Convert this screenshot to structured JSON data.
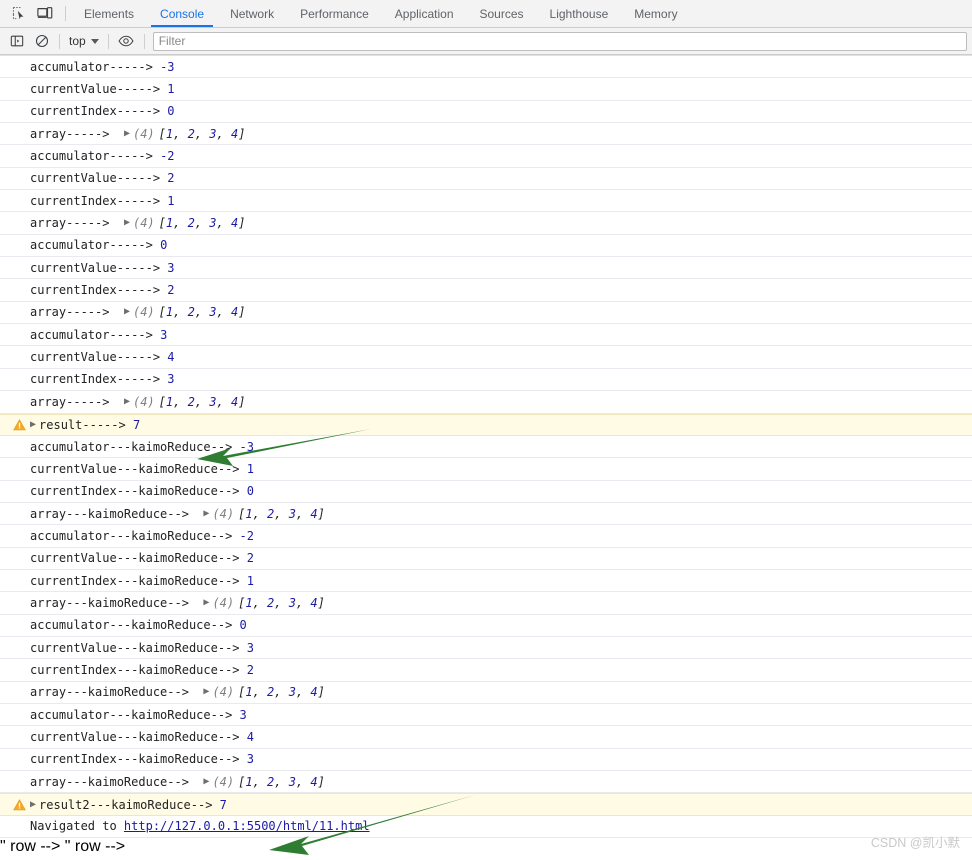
{
  "tabbar": {
    "icons": [
      {
        "name": "inspect-element-icon",
        "label": "Inspect element"
      },
      {
        "name": "device-toolbar-icon",
        "label": "Toggle device toolbar"
      }
    ],
    "tabs": [
      {
        "label": "Elements",
        "active": false
      },
      {
        "label": "Console",
        "active": true
      },
      {
        "label": "Network",
        "active": false
      },
      {
        "label": "Performance",
        "active": false
      },
      {
        "label": "Application",
        "active": false
      },
      {
        "label": "Sources",
        "active": false
      },
      {
        "label": "Lighthouse",
        "active": false
      },
      {
        "label": "Memory",
        "active": false
      }
    ],
    "active_tab": "Console",
    "active_color": "#1a73e8"
  },
  "toolbar": {
    "sidebar_toggle_icon": "console-sidebar-icon",
    "clear_console_icon": "clear-console-icon",
    "context_label": "top",
    "live_expression_icon": "eye-icon",
    "filter_placeholder": "Filter",
    "filter_value": ""
  },
  "console": {
    "array_count": "(4)",
    "array_literal": "[1, 2, 3, 4]",
    "array_values": [
      1,
      2,
      3,
      4
    ],
    "messages": [
      {
        "type": "log",
        "label": "accumulator----->",
        "value": "-3"
      },
      {
        "type": "log",
        "label": "currentValue----->",
        "value": "1"
      },
      {
        "type": "log",
        "label": "currentIndex----->",
        "value": "0"
      },
      {
        "type": "array",
        "label": "array----->"
      },
      {
        "type": "log",
        "label": "accumulator----->",
        "value": "-2"
      },
      {
        "type": "log",
        "label": "currentValue----->",
        "value": "2"
      },
      {
        "type": "log",
        "label": "currentIndex----->",
        "value": "1"
      },
      {
        "type": "array",
        "label": "array----->"
      },
      {
        "type": "log",
        "label": "accumulator----->",
        "value": "0"
      },
      {
        "type": "log",
        "label": "currentValue----->",
        "value": "3"
      },
      {
        "type": "log",
        "label": "currentIndex----->",
        "value": "2"
      },
      {
        "type": "array",
        "label": "array----->"
      },
      {
        "type": "log",
        "label": "accumulator----->",
        "value": "3"
      },
      {
        "type": "log",
        "label": "currentValue----->",
        "value": "4"
      },
      {
        "type": "log",
        "label": "currentIndex----->",
        "value": "3"
      },
      {
        "type": "array",
        "label": "array----->"
      },
      {
        "type": "warn",
        "label": "result----->",
        "value": "7"
      },
      {
        "type": "log",
        "label": "accumulator---kaimoReduce-->",
        "value": "-3"
      },
      {
        "type": "log",
        "label": "currentValue---kaimoReduce-->",
        "value": "1"
      },
      {
        "type": "log",
        "label": "currentIndex---kaimoReduce-->",
        "value": "0"
      },
      {
        "type": "array",
        "label": "array---kaimoReduce-->"
      },
      {
        "type": "log",
        "label": "accumulator---kaimoReduce-->",
        "value": "-2"
      },
      {
        "type": "log",
        "label": "currentValue---kaimoReduce-->",
        "value": "2"
      },
      {
        "type": "log",
        "label": "currentIndex---kaimoReduce-->",
        "value": "1"
      },
      {
        "type": "array",
        "label": "array---kaimoReduce-->"
      },
      {
        "type": "log",
        "label": "accumulator---kaimoReduce-->",
        "value": "0"
      },
      {
        "type": "log",
        "label": "currentValue---kaimoReduce-->",
        "value": "3"
      },
      {
        "type": "log",
        "label": "currentIndex---kaimoReduce-->",
        "value": "2"
      },
      {
        "type": "array",
        "label": "array---kaimoReduce-->"
      },
      {
        "type": "log",
        "label": "accumulator---kaimoReduce-->",
        "value": "3"
      },
      {
        "type": "log",
        "label": "currentValue---kaimoReduce-->",
        "value": "4"
      },
      {
        "type": "log",
        "label": "currentIndex---kaimoReduce-->",
        "value": "3"
      },
      {
        "type": "array",
        "label": "array---kaimoReduce-->"
      },
      {
        "type": "warn",
        "label": "result2---kaimoReduce-->",
        "value": "7"
      },
      {
        "type": "nav",
        "label": "Navigated to ",
        "value": "http://127.0.0.1:5500/html/11.html"
      }
    ]
  },
  "annotations": {
    "arrow_color": "#2e7d32",
    "arrows": [
      {
        "name": "annotation-arrow-result",
        "points_to": "result----->"
      },
      {
        "name": "annotation-arrow-result2",
        "points_to": "result2---kaimoReduce-->"
      }
    ]
  },
  "watermark": {
    "text": "CSDN @凯小默"
  }
}
